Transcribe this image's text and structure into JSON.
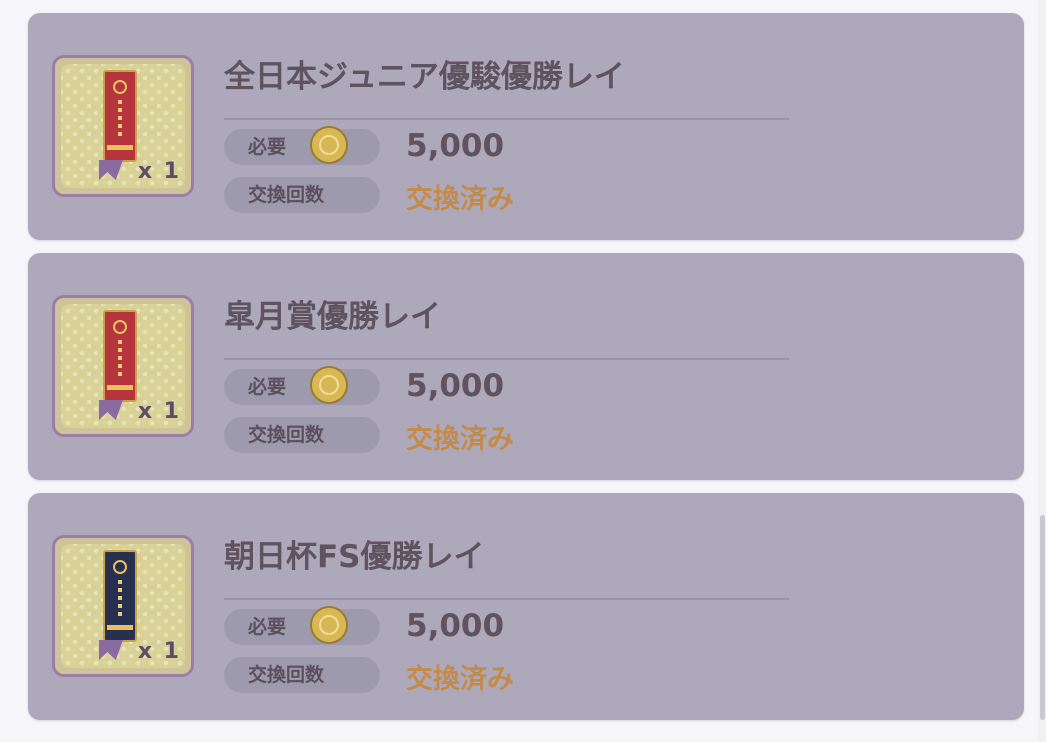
{
  "items": [
    {
      "title": "全日本ジュニア優駿優勝レイ",
      "quantity": "x 1",
      "required_label": "必要",
      "cost": "5,000",
      "exchange_count_label": "交換回数",
      "status": "交換済み",
      "ribbon_color": "#b5343d"
    },
    {
      "title": "皐月賞優勝レイ",
      "quantity": "x 1",
      "required_label": "必要",
      "cost": "5,000",
      "exchange_count_label": "交換回数",
      "status": "交換済み",
      "ribbon_color": "#b5343d"
    },
    {
      "title": "朝日杯FS優勝レイ",
      "quantity": "x 1",
      "required_label": "必要",
      "cost": "5,000",
      "exchange_count_label": "交換回数",
      "status": "交換済み",
      "ribbon_color": "#283052"
    }
  ],
  "colors": {
    "card_bg": "#ada9bb",
    "status_text": "#c48a4a",
    "title_text": "#5e535e"
  },
  "icons": {
    "coin": "coin-icon",
    "ribbon": "ribbon-icon"
  }
}
